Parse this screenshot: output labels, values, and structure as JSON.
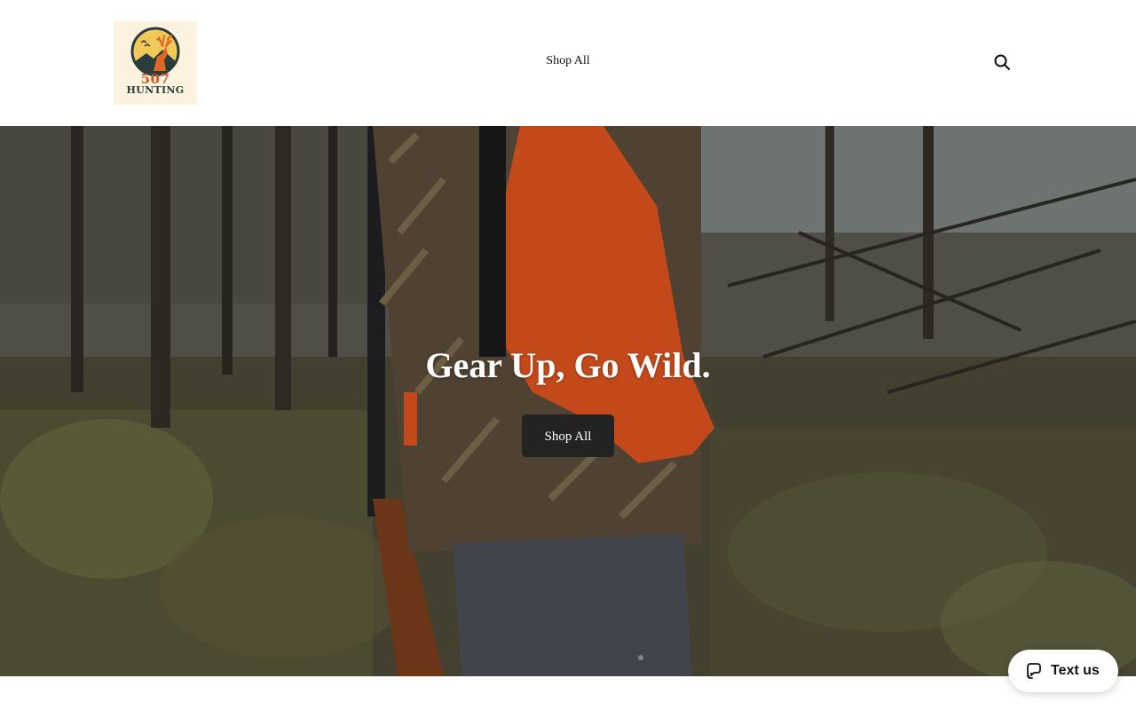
{
  "brand": {
    "logo_number": "507",
    "logo_word": "HUNTING",
    "colors": {
      "orange": "#d9531e",
      "teal": "#2a3d3c",
      "cream": "#fbf3df"
    }
  },
  "header": {
    "nav": [
      {
        "label": "Shop All"
      }
    ],
    "search_icon": "search-icon"
  },
  "hero": {
    "title": "Gear Up, Go Wild.",
    "button_label": "Shop All",
    "button_color": "#232323"
  },
  "widget": {
    "label": "Text us",
    "icon": "chat-bubble-icon"
  }
}
